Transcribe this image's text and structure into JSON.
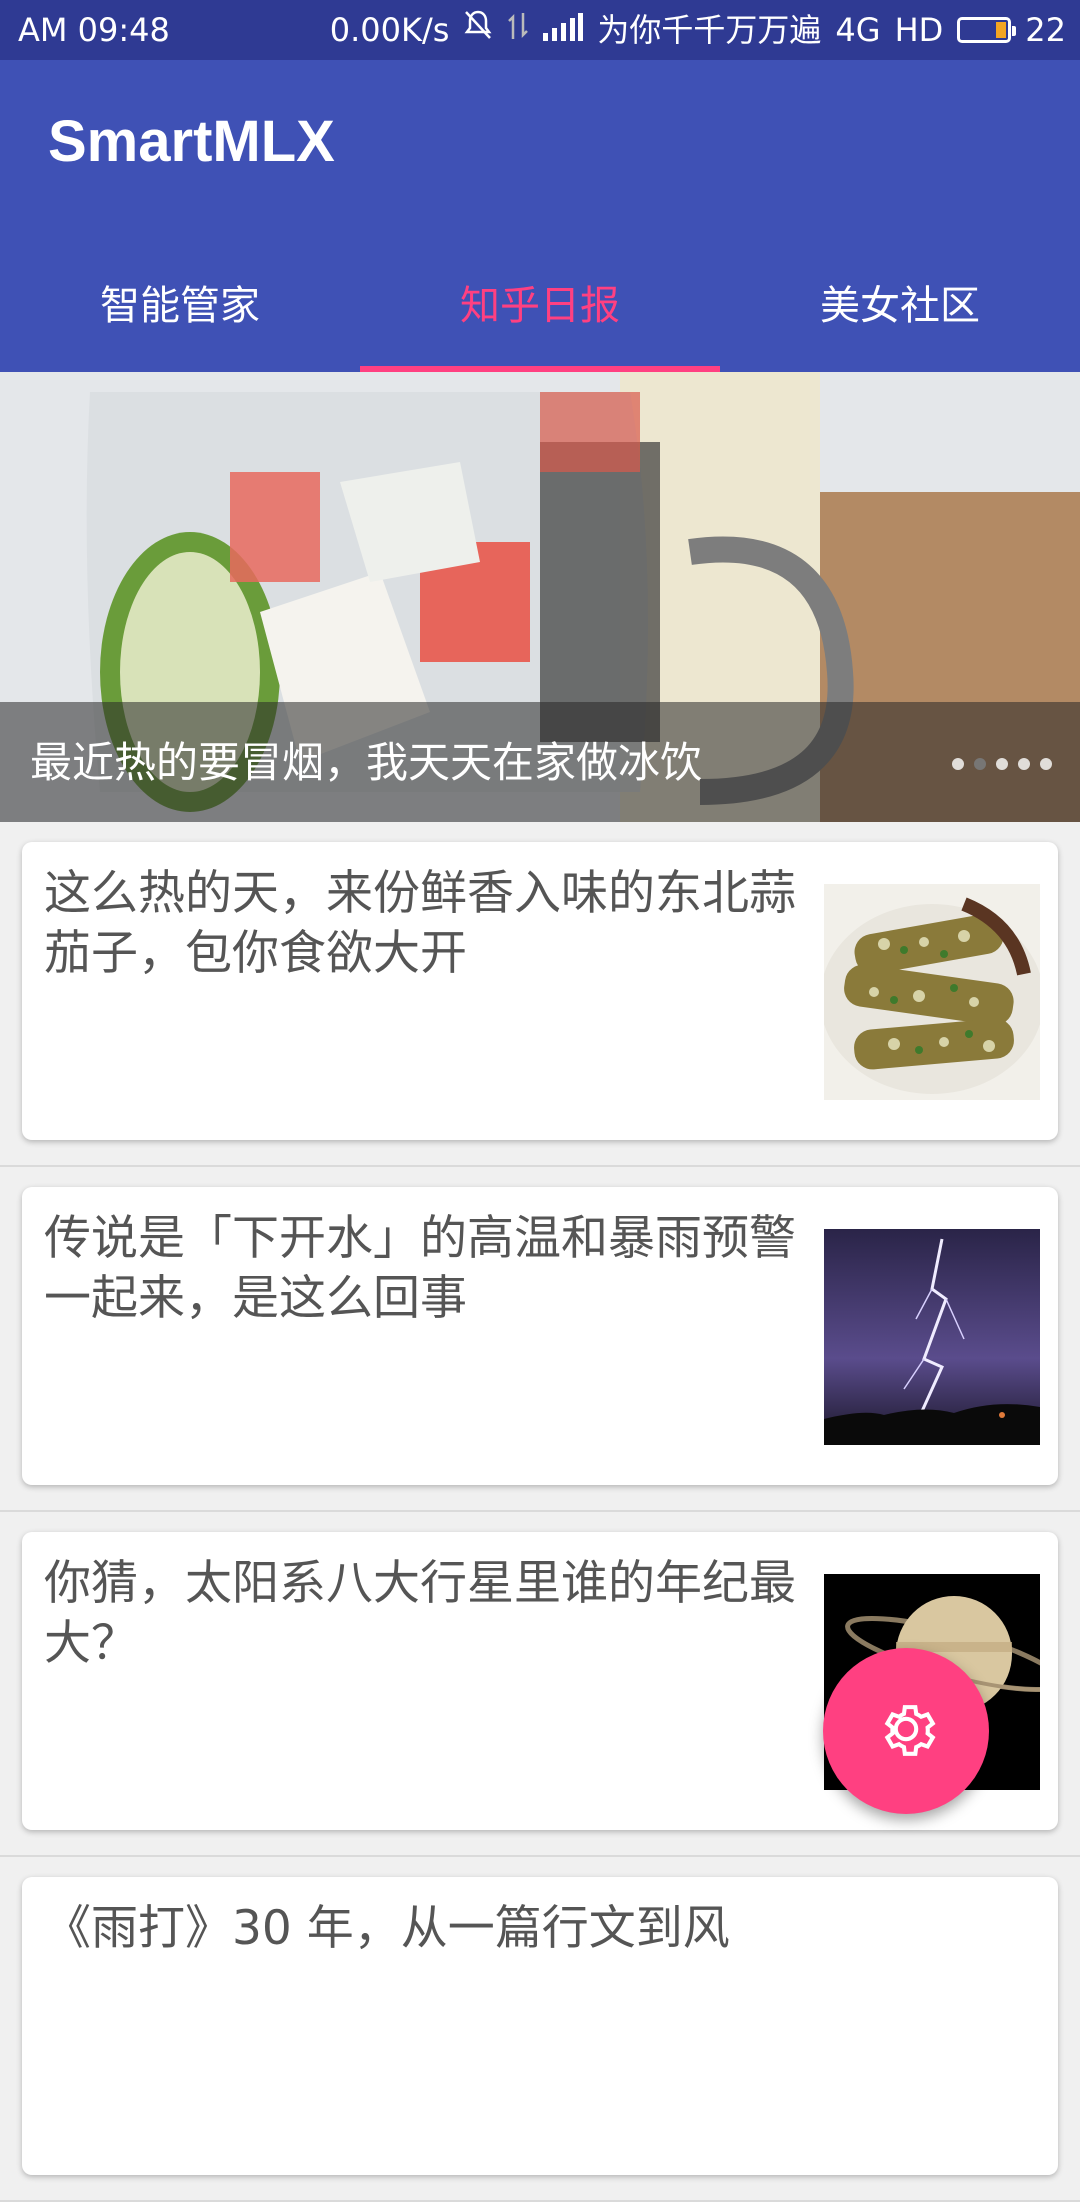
{
  "status_bar": {
    "ampm": "AM",
    "time": "09:48",
    "net_speed": "0.00K/s",
    "carrier": "为你千千万万遍",
    "network": "4G",
    "hd": "HD",
    "battery": "22",
    "icons": [
      "bell-off-icon",
      "data-arrows-icon",
      "signal-icon",
      "battery-icon"
    ]
  },
  "app_bar": {
    "title": "SmartMLX",
    "color": "#3f51b5"
  },
  "tabs": [
    {
      "label": "智能管家",
      "active": false
    },
    {
      "label": "知乎日报",
      "active": true
    },
    {
      "label": "美女社区",
      "active": false
    }
  ],
  "accent": "#ff4081",
  "banner": {
    "caption": "最近热的要冒烟，我天天在家做冰饮",
    "page_dots": 5,
    "active_dot": 2
  },
  "stories": [
    {
      "title": "这么热的天，来份鲜香入味的东北蒜茄子，包你食欲大开",
      "thumb": "eggplant-dish-image"
    },
    {
      "title": "传说是「下开水」的高温和暴雨预警一起来，是这么回事",
      "thumb": "lightning-storm-image"
    },
    {
      "title": "你猜，太阳系八大行星里谁的年纪最大？",
      "thumb": "saturn-planet-image"
    },
    {
      "title": "《雨打》30 年，从一篇行文到风",
      "thumb": ""
    }
  ],
  "fab": {
    "icon": "gear-icon"
  }
}
